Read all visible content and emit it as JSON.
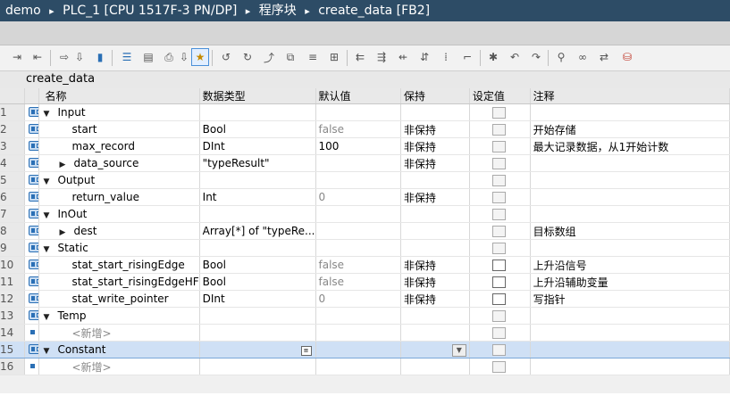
{
  "breadcrumb": {
    "project": "demo",
    "device": "PLC_1 [CPU 1517F-3 PN/DP]",
    "folder": "程序块",
    "block": "create_data [FB2]",
    "separator": "▸"
  },
  "block_title": "create_data",
  "columns": {
    "name": "名称",
    "datatype": "数据类型",
    "default": "默认值",
    "retain": "保持",
    "setpoint": "设定值",
    "comment": "注释"
  },
  "rows": [
    {
      "num": "1",
      "name": "Input",
      "type": "",
      "default": "",
      "retain": "",
      "comment": ""
    },
    {
      "num": "2",
      "name": "start",
      "type": "Bool",
      "default": "false",
      "retain": "非保持",
      "comment": "开始存储"
    },
    {
      "num": "3",
      "name": "max_record",
      "type": "DInt",
      "default": "100",
      "retain": "非保持",
      "comment": "最大记录数据，从1开始计数"
    },
    {
      "num": "4",
      "name": "data_source",
      "type": "\"typeResult\"",
      "default": "",
      "retain": "非保持",
      "comment": ""
    },
    {
      "num": "5",
      "name": "Output",
      "type": "",
      "default": "",
      "retain": "",
      "comment": ""
    },
    {
      "num": "6",
      "name": "return_value",
      "type": "Int",
      "default": "0",
      "retain": "非保持",
      "comment": ""
    },
    {
      "num": "7",
      "name": "InOut",
      "type": "",
      "default": "",
      "retain": "",
      "comment": ""
    },
    {
      "num": "8",
      "name": "dest",
      "type": "Array[*] of \"typeRe...",
      "default": "",
      "retain": "",
      "comment": "目标数组"
    },
    {
      "num": "9",
      "name": "Static",
      "type": "",
      "default": "",
      "retain": "",
      "comment": ""
    },
    {
      "num": "10",
      "name": "stat_start_risingEdge",
      "type": "Bool",
      "default": "false",
      "retain": "非保持",
      "comment": "上升沿信号"
    },
    {
      "num": "11",
      "name": "stat_start_risingEdgeHF",
      "type": "Bool",
      "default": "false",
      "retain": "非保持",
      "comment": "上升沿辅助变量"
    },
    {
      "num": "12",
      "name": "stat_write_pointer",
      "type": "DInt",
      "default": "0",
      "retain": "非保持",
      "comment": "写指针"
    },
    {
      "num": "13",
      "name": "Temp",
      "type": "",
      "default": "",
      "retain": "",
      "comment": ""
    },
    {
      "num": "14",
      "name": "<新增>",
      "type": "",
      "default": "",
      "retain": "",
      "comment": ""
    },
    {
      "num": "15",
      "name": "Constant",
      "type": "",
      "default": "",
      "retain": "",
      "comment": ""
    },
    {
      "num": "16",
      "name": "<新增>",
      "type": "",
      "default": "",
      "retain": "",
      "comment": ""
    }
  ],
  "toolbar_icons": [
    "insert-row-icon",
    "add-row-icon",
    "expand-icon",
    "monitor-icon",
    "list-view-icon",
    "block-view-icon",
    "save-snapshot-icon",
    "highlight-icon",
    "call-icon",
    "network-icon",
    "jump-icon",
    "copy-block-icon",
    "paste-icon",
    "filter-icon",
    "first-icon",
    "indent-icon",
    "outdent-icon",
    "sort-icon",
    "list-icon",
    "label-icon",
    "breakpoint-icon",
    "step-icon",
    "run-icon",
    "zoom-icon",
    "glasses-icon",
    "compare-icon",
    "db-icon"
  ],
  "colors": {
    "titlebar": "#2d4c66",
    "selected_row": "#cfe0f5",
    "icon_blue": "#2a6fb5"
  }
}
